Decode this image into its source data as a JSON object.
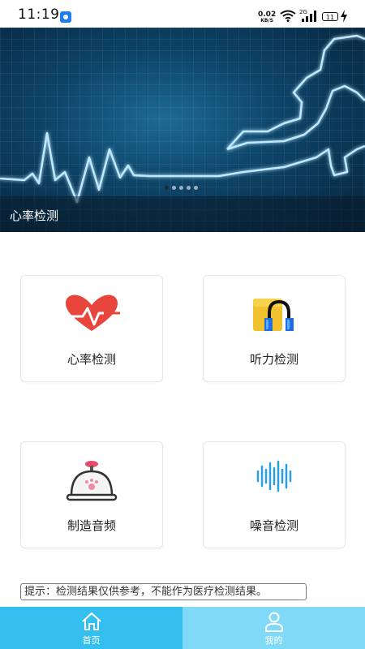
{
  "status_bar": {
    "time": "11:19",
    "net_speed": "0.02",
    "net_unit": "KB/S",
    "signal_label": "2G",
    "battery": "11"
  },
  "banner": {
    "caption": "心率检测",
    "slide_count": 5,
    "active_slide": 1
  },
  "features": [
    {
      "label": "心率检测",
      "icon": "heart-rate-icon"
    },
    {
      "label": "听力检测",
      "icon": "headphones-icon"
    },
    {
      "label": "制造音频",
      "icon": "bell-icon"
    },
    {
      "label": "噪音检测",
      "icon": "sound-wave-icon"
    }
  ],
  "tip": "提示：检测结果仅供参考，不能作为医疗检测结果。",
  "bottom_nav": [
    {
      "label": "首页",
      "icon": "home-icon",
      "active": true
    },
    {
      "label": "我的",
      "icon": "user-icon",
      "active": false
    }
  ],
  "colors": {
    "nav_active": "#35bfef",
    "nav_inactive": "#7fd9f7",
    "heart": "#e8463c"
  }
}
